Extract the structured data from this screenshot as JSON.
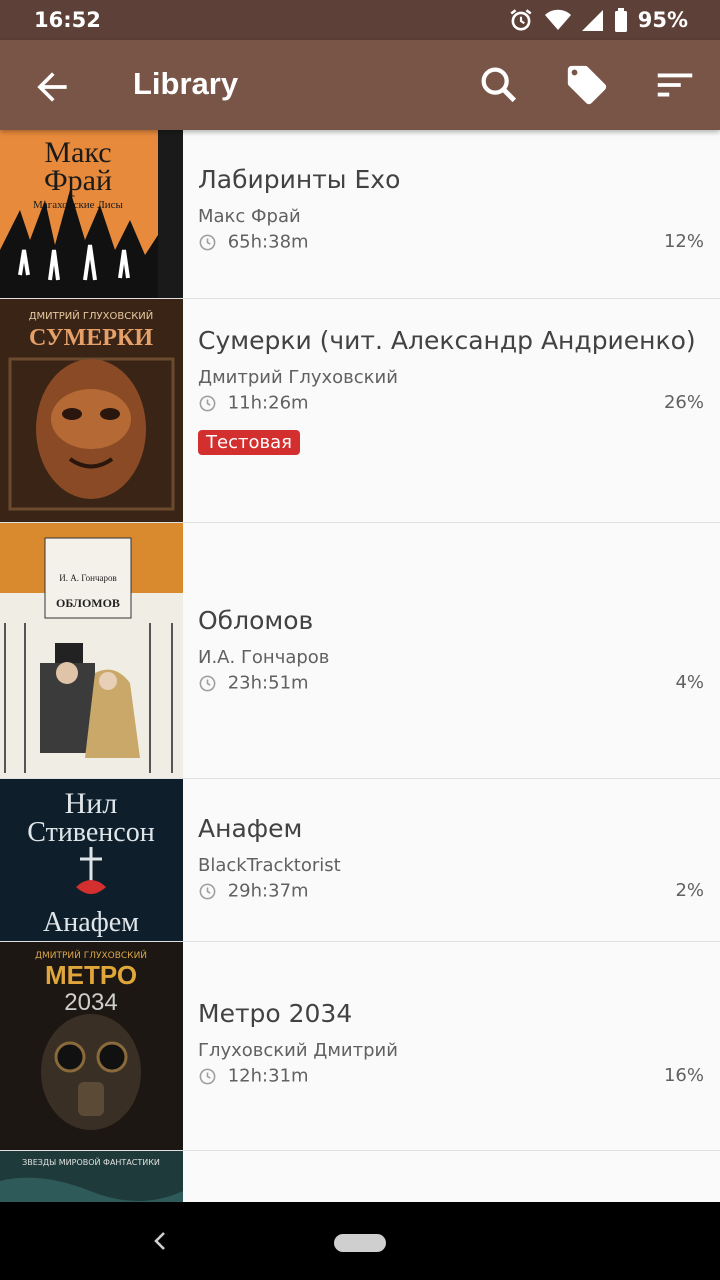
{
  "status_bar": {
    "time": "16:52",
    "battery": "95%",
    "icons": [
      "alarm-icon",
      "wifi-icon",
      "signal-icon",
      "battery-icon"
    ]
  },
  "app_bar": {
    "title": "Library",
    "actions": [
      "search-icon",
      "tag-icon",
      "sort-icon"
    ],
    "color": "#795548"
  },
  "books": [
    {
      "title": "Лабиринты Ехо",
      "author": "Макс Фрай",
      "duration": "65h:38m",
      "progress": "12%",
      "tag": "",
      "cover": {
        "line1": "Макс",
        "line2": "Фрай",
        "line3": "Мага­хонские Лисы"
      }
    },
    {
      "title": "Сумерки (чит. Александр Андриенко)",
      "author": "Дмитрий Глуховский",
      "duration": "11h:26m",
      "progress": "26%",
      "tag": "Тестовая",
      "cover": {
        "line1": "ДМИТРИЙ ГЛУХОВСКИЙ",
        "line2": "СУМЕРКИ"
      }
    },
    {
      "title": "Обломов",
      "author": "И.А. Гончаров",
      "duration": "23h:51m",
      "progress": "4%",
      "tag": "",
      "cover": {
        "line1": "И. А. Гончаров",
        "line2": "ОБЛОМОВ"
      }
    },
    {
      "title": "Анафем",
      "author": "BlackTracktorist",
      "duration": "29h:37m",
      "progress": "2%",
      "tag": "",
      "cover": {
        "line1": "Нил",
        "line2": "Стивенсон",
        "line3": "Анафем"
      }
    },
    {
      "title": "Метро 2034",
      "author": "Глуховский Дмитрий",
      "duration": "12h:31m",
      "progress": "16%",
      "tag": "",
      "cover": {
        "line1": "ДМИТРИЙ ГЛУХОВСКИЙ",
        "line2": "МЕТРО",
        "line3": "2034"
      }
    },
    {
      "title": "",
      "author": "",
      "duration": "",
      "progress": "",
      "tag": "",
      "cover": {
        "line1": "ЗВЕЗДЫ МИРОВОЙ ФАНТАСТИКИ"
      }
    }
  ],
  "tag_color": "#d32f2f"
}
